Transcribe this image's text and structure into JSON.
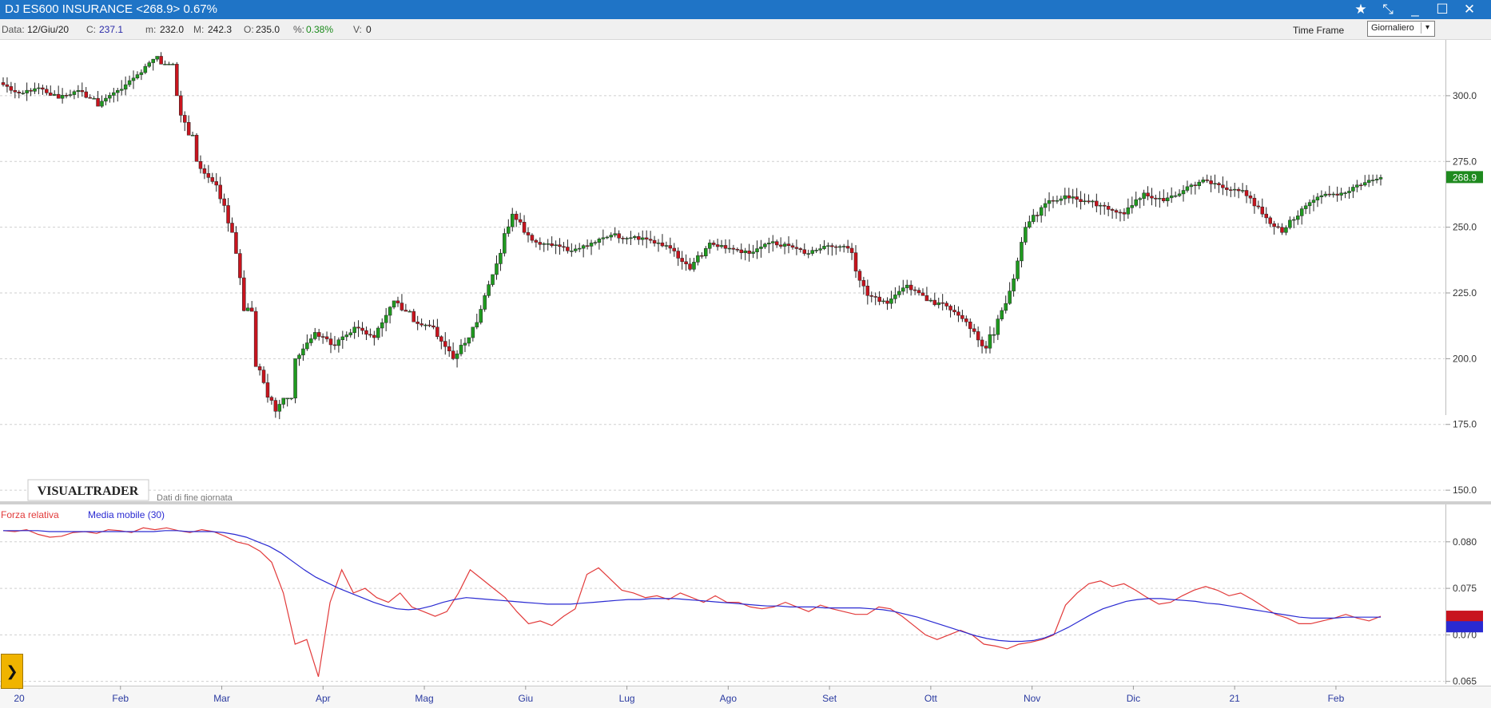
{
  "window": {
    "title": "DJ ES600 INSURANCE <268.9> 0.67%",
    "controls": [
      "★",
      "⤡",
      "_",
      "☐",
      "✕"
    ]
  },
  "infobar": {
    "date_label": "Data:",
    "date_value": "12/Giu/20",
    "close_label": "C:",
    "close_value": "237.1",
    "min_label": "m:",
    "min_value": "232.0",
    "max_label": "M:",
    "max_value": "242.3",
    "open_label": "O:",
    "open_value": "235.0",
    "pct_label": "%:",
    "pct_value": "0.38%",
    "vol_label": "V:",
    "vol_value": "0",
    "timeframe_label": "Time Frame",
    "timeframe_value": "Giornaliero"
  },
  "branding": {
    "logo": "VISUALTRADER",
    "note": "Dati di fine giornata"
  },
  "side_button": "❯",
  "chart_data": [
    {
      "type": "candlestick",
      "y_ticks": [
        "300.0",
        "275.0",
        "250.0",
        "225.0",
        "200.0",
        "175.0",
        "150.0"
      ],
      "ylim": [
        147,
        320
      ],
      "last_price": "268.9",
      "up_color": "#1f9a1f",
      "down_color": "#c8141e",
      "series": [
        {
          "weeks": [
            [
              305,
              307,
              299,
              301
            ],
            [
              301,
              305,
              298,
              303
            ],
            [
              303,
              307,
              300,
              299
            ],
            [
              299,
              304,
              297,
              302
            ],
            [
              302,
              306,
              299,
              296
            ],
            [
              296,
              303,
              294,
              302
            ],
            [
              302,
              310,
              300,
              308
            ],
            [
              308,
              314,
              306,
              315
            ],
            [
              315,
              317,
              312,
              300
            ],
            [
              300,
              303,
              285,
              275
            ],
            [
              275,
              280,
              255,
              266
            ],
            [
              266,
              272,
              248,
              240
            ],
            [
              240,
              244,
              218,
              197
            ],
            [
              197,
              205,
              165,
              180
            ],
            [
              180,
              185,
              163,
              200
            ],
            [
              200,
              215,
              195,
              210
            ],
            [
              210,
              216,
              200,
              205
            ],
            [
              205,
              214,
              199,
              212
            ],
            [
              212,
              216,
              204,
              208
            ],
            [
              208,
              220,
              205,
              222
            ],
            [
              222,
              231,
              218,
              214
            ],
            [
              214,
              218,
              205,
              212
            ],
            [
              212,
              216,
              198,
              200
            ],
            [
              200,
              208,
              195,
              212
            ],
            [
              212,
              232,
              208,
              232
            ],
            [
              232,
              258,
              230,
              255
            ],
            [
              255,
              258,
              244,
              245
            ],
            [
              245,
              248,
              230,
              243
            ],
            [
              243,
              247,
              235,
              241
            ],
            [
              241,
              246,
              236,
              244
            ],
            [
              244,
              250,
              240,
              247
            ],
            [
              247,
              252,
              243,
              246
            ],
            [
              246,
              251,
              240,
              245
            ],
            [
              245,
              248,
              240,
              242
            ],
            [
              242,
              244,
              229,
              234
            ],
            [
              234,
              246,
              232,
              244
            ],
            [
              244,
              249,
              240,
              242
            ],
            [
              242,
              246,
              236,
              240
            ],
            [
              240,
              246,
              236,
              244
            ],
            [
              244,
              248,
              238,
              243
            ],
            [
              243,
              247,
              238,
              240
            ],
            [
              240,
              246,
              236,
              243
            ],
            [
              243,
              246,
              236,
              242
            ],
            [
              242,
              244,
              218,
              224
            ],
            [
              224,
              226,
              215,
              221
            ],
            [
              221,
              230,
              218,
              228
            ],
            [
              228,
              232,
              224,
              222
            ],
            [
              222,
              226,
              216,
              220
            ],
            [
              220,
              224,
              210,
              214
            ],
            [
              214,
              216,
              202,
              204
            ],
            [
              204,
              224,
              202,
              221
            ],
            [
              221,
              252,
              219,
              250
            ],
            [
              250,
              262,
              248,
              259
            ],
            [
              259,
              265,
              255,
              262
            ],
            [
              262,
              265,
              256,
              260
            ],
            [
              260,
              264,
              254,
              258
            ],
            [
              258,
              262,
              250,
              255
            ],
            [
              255,
              266,
              253,
              263
            ],
            [
              263,
              266,
              255,
              260
            ],
            [
              260,
              266,
              255,
              264
            ],
            [
              264,
              271,
              261,
              268
            ],
            [
              268,
              270,
              262,
              265
            ],
            [
              265,
              268,
              258,
              264
            ],
            [
              264,
              266,
              250,
              255
            ],
            [
              255,
              258,
              245,
              248
            ],
            [
              248,
              258,
              246,
              257
            ],
            [
              257,
              264,
              255,
              262
            ],
            [
              262,
              266,
              258,
              263
            ],
            [
              263,
              268,
              260,
              266
            ],
            [
              266,
              270,
              262,
              268.9
            ]
          ]
        }
      ]
    },
    {
      "type": "line",
      "y_ticks": [
        "0.080",
        "0.075",
        "0.070",
        "0.065"
      ],
      "ylim": [
        0.0648,
        0.0835
      ],
      "series": [
        {
          "name": "Forza relativa",
          "color": "#e23a3a",
          "values": [
            0.0812,
            0.0811,
            0.0813,
            0.0808,
            0.0805,
            0.0806,
            0.081,
            0.0811,
            0.0809,
            0.0813,
            0.0812,
            0.081,
            0.0815,
            0.0813,
            0.0815,
            0.0812,
            0.081,
            0.0813,
            0.0811,
            0.0806,
            0.08,
            0.0797,
            0.079,
            0.0778,
            0.0745,
            0.069,
            0.0695,
            0.0655,
            0.0735,
            0.077,
            0.0745,
            0.075,
            0.074,
            0.0735,
            0.0745,
            0.073,
            0.0725,
            0.072,
            0.0725,
            0.0745,
            0.077,
            0.076,
            0.075,
            0.074,
            0.0725,
            0.0712,
            0.0715,
            0.071,
            0.072,
            0.0728,
            0.0765,
            0.0772,
            0.076,
            0.0748,
            0.0745,
            0.074,
            0.0742,
            0.0738,
            0.0745,
            0.074,
            0.0735,
            0.0742,
            0.0735,
            0.0735,
            0.073,
            0.0728,
            0.073,
            0.0735,
            0.073,
            0.0725,
            0.0732,
            0.0728,
            0.0725,
            0.0722,
            0.0722,
            0.073,
            0.0728,
            0.072,
            0.071,
            0.07,
            0.0695,
            0.07,
            0.0705,
            0.07,
            0.069,
            0.0688,
            0.0685,
            0.069,
            0.0692,
            0.0695,
            0.07,
            0.0732,
            0.0745,
            0.0755,
            0.0758,
            0.0752,
            0.0755,
            0.0748,
            0.074,
            0.0733,
            0.0735,
            0.0742,
            0.0748,
            0.0752,
            0.0748,
            0.0742,
            0.0745,
            0.0738,
            0.073,
            0.0722,
            0.0718,
            0.0712,
            0.0712,
            0.0715,
            0.0718,
            0.0722,
            0.0718,
            0.0715,
            0.072
          ]
        },
        {
          "name": "Media mobile (30)",
          "color": "#2a2ad2",
          "values": [
            0.0812,
            0.0812,
            0.0812,
            0.0812,
            0.0811,
            0.0811,
            0.0811,
            0.0811,
            0.0811,
            0.0811,
            0.0811,
            0.0811,
            0.0811,
            0.0811,
            0.0812,
            0.0812,
            0.0811,
            0.0811,
            0.0811,
            0.081,
            0.0808,
            0.0805,
            0.08,
            0.0795,
            0.0788,
            0.0779,
            0.077,
            0.0762,
            0.0756,
            0.075,
            0.0745,
            0.074,
            0.0735,
            0.0731,
            0.0728,
            0.0727,
            0.0728,
            0.0731,
            0.0735,
            0.0738,
            0.074,
            0.0739,
            0.0738,
            0.0737,
            0.0736,
            0.0735,
            0.0734,
            0.0733,
            0.0733,
            0.0733,
            0.0734,
            0.0735,
            0.0736,
            0.0737,
            0.0738,
            0.0738,
            0.0739,
            0.0739,
            0.0739,
            0.0738,
            0.0737,
            0.0736,
            0.0735,
            0.0734,
            0.0733,
            0.0732,
            0.0731,
            0.0731,
            0.073,
            0.073,
            0.073,
            0.0729,
            0.0729,
            0.0729,
            0.0729,
            0.0728,
            0.0727,
            0.0725,
            0.0722,
            0.0719,
            0.0715,
            0.0711,
            0.0707,
            0.0703,
            0.0699,
            0.0696,
            0.0694,
            0.0693,
            0.0693,
            0.0694,
            0.0697,
            0.0702,
            0.0708,
            0.0715,
            0.0722,
            0.0728,
            0.0732,
            0.0736,
            0.0738,
            0.0739,
            0.0739,
            0.0738,
            0.0737,
            0.0736,
            0.0734,
            0.0733,
            0.0731,
            0.0729,
            0.0727,
            0.0725,
            0.0723,
            0.0721,
            0.0719,
            0.0718,
            0.0718,
            0.0718,
            0.0719,
            0.0719,
            0.0719,
            0.0719
          ]
        }
      ]
    }
  ],
  "x_axis": {
    "labels": [
      "20",
      "Feb",
      "Mar",
      "Apr",
      "Mag",
      "Giu",
      "Lug",
      "Ago",
      "Set",
      "Ott",
      "Nov",
      "Dic",
      "21",
      "Feb"
    ]
  }
}
